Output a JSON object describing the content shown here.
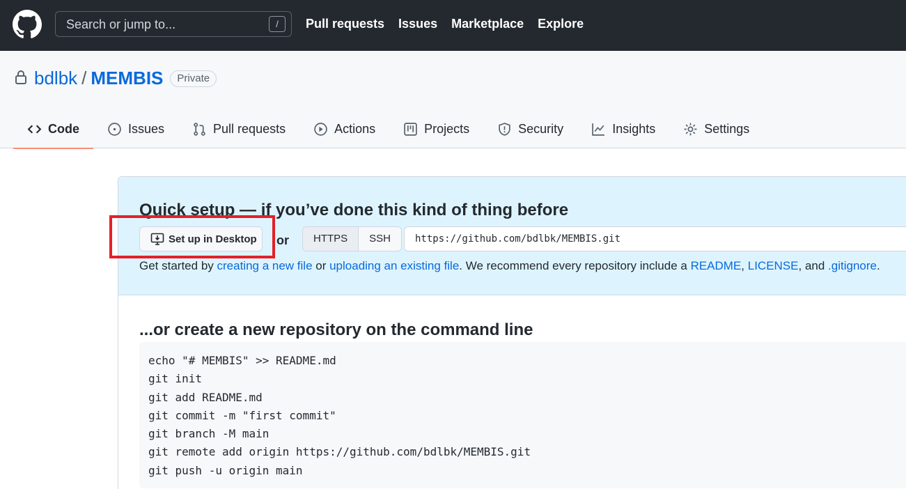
{
  "header": {
    "search_placeholder": "Search or jump to...",
    "search_shortcut": "/",
    "nav": [
      "Pull requests",
      "Issues",
      "Marketplace",
      "Explore"
    ]
  },
  "repo": {
    "owner": "bdlbk",
    "separator": "/",
    "name": "MEMBIS",
    "visibility": "Private"
  },
  "tabs": [
    {
      "label": "Code",
      "icon": "code-icon",
      "active": true
    },
    {
      "label": "Issues",
      "icon": "issue-icon"
    },
    {
      "label": "Pull requests",
      "icon": "pull-request-icon"
    },
    {
      "label": "Actions",
      "icon": "play-icon"
    },
    {
      "label": "Projects",
      "icon": "project-icon"
    },
    {
      "label": "Security",
      "icon": "shield-icon"
    },
    {
      "label": "Insights",
      "icon": "graph-icon"
    },
    {
      "label": "Settings",
      "icon": "gear-icon"
    }
  ],
  "quick_setup": {
    "title": "Quick setup — if you’ve done this kind of thing before",
    "desktop_button": "Set up in Desktop",
    "or": "or",
    "protocols": [
      "HTTPS",
      "SSH"
    ],
    "selected_protocol": "HTTPS",
    "clone_url": "https://github.com/bdlbk/MEMBIS.git",
    "line": {
      "t1": "Get started by ",
      "link_new_file": "creating a new file",
      "t2": " or ",
      "link_upload": "uploading an existing file",
      "t3": ". We recommend every repository include a ",
      "link_readme": "README",
      "t4": ", ",
      "link_license": "LICENSE",
      "t5": ", and ",
      "link_gitignore": ".gitignore",
      "t6": "."
    }
  },
  "command_line": {
    "title": "...or create a new repository on the command line",
    "lines": [
      "echo \"# MEMBIS\" >> README.md",
      "git init",
      "git add README.md",
      "git commit -m \"first commit\"",
      "git branch -M main",
      "git remote add origin https://github.com/bdlbk/MEMBIS.git",
      "git push -u origin main"
    ]
  },
  "colors": {
    "header_bg": "#24292f",
    "link": "#0969da",
    "active_tab_underline": "#fd8c73",
    "quick_setup_bg": "#ddf4ff",
    "highlight": "#e32128"
  }
}
